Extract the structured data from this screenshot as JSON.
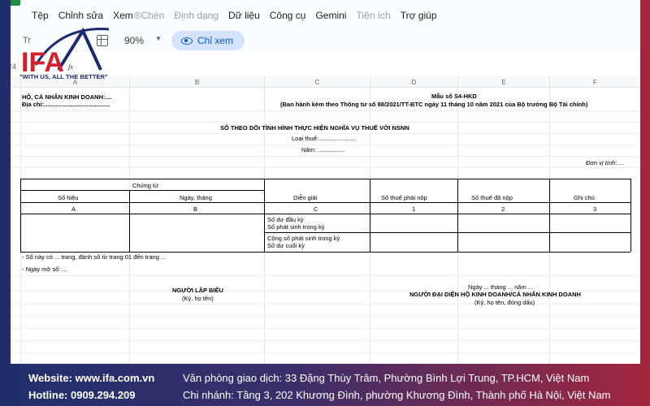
{
  "menu": {
    "items": [
      {
        "label": "Tệp",
        "disabled": false
      },
      {
        "label": "Chỉnh sửa",
        "disabled": false
      },
      {
        "label": "Xem",
        "disabled": false
      },
      {
        "label": "®Chèn",
        "disabled": true
      },
      {
        "label": "Định dạng",
        "disabled": true
      },
      {
        "label": "Dữ liệu",
        "disabled": false
      },
      {
        "label": "Công cụ",
        "disabled": false
      },
      {
        "label": "Gemini",
        "disabled": false
      },
      {
        "label": "Tiện ích",
        "disabled": true
      },
      {
        "label": "Trợ giúp",
        "disabled": false
      }
    ]
  },
  "toolbar": {
    "search_label": "Tr",
    "zoom": "90%",
    "view_button": "Chỉ xem"
  },
  "cell_ref": "24",
  "logo": {
    "letters": "IFA",
    "fx": "fx",
    "tagline": "\"WITH US, ALL THE BETTER\""
  },
  "columns": [
    "A",
    "B",
    "C",
    "D",
    "E",
    "F"
  ],
  "sheet": {
    "org_name": "HỘ, CÁ NHÂN KINH DOANH:....",
    "address": "Địa chỉ:.......................................",
    "form_code": "Mẫu số S4-HKD",
    "form_note": "(Ban hành kèm theo Thông tư số 88/2021/TT-BTC ngày 11 tháng 10 năm 2021 của Bộ trưởng Bộ Tài chính)",
    "title": "SỔ THEO DÕI TÌNH HÌNH THỰC HIỆN NGHĨA VỤ THUẾ VỚI NSNN",
    "tax_type": "Loại thuế:......................",
    "year": "Năm: ................",
    "unit": "Đơn vị tính:....",
    "table": {
      "group_header": "Chứng từ",
      "headers": [
        "Số hiệu",
        "Ngày, tháng",
        "Diễn giải",
        "Số thuế phải nộp",
        "Số thuế đã nộp",
        "Ghi chú"
      ],
      "codes": [
        "A",
        "B",
        "C",
        "1",
        "2",
        "3"
      ],
      "rows": [
        "Số dư đầu kỳ",
        "Số phát sinh trong kỳ",
        "Cộng số phát sinh trong kỳ",
        "Số dư cuối kỳ"
      ]
    },
    "pages_note": "- Sổ này có ... trang, đánh số từ trang 01 đến trang ...",
    "open_date": "- Ngày mở sổ: ...",
    "preparer": "NGƯỜI LẬP BIỂU",
    "preparer_sign": "(Ký, họ tên)",
    "date_line": "Ngày ... tháng ... năm ...",
    "representative": "NGƯỜI ĐẠI DIỆN HỘ KINH DOANH/CÁ NHÂN KINH DOANH",
    "representative_sign": "(Ký, họ tên, đóng dấu)"
  },
  "footer": {
    "website": "Website: www.ifa.com.vn",
    "hotline": "Hotline: 0909.294.209",
    "office": "Văn phòng giao dịch: 33 Đặng Thùy Trâm, Phường Bình Lợi Trung, TP.HCM, Việt Nam",
    "branch": "Chi nhánh: Tầng 3, 202 Khương Đình, phường Khương Đình, Thành phố Hà Nội, Việt Nam"
  },
  "colors": {
    "accent": "#0b57d0",
    "view_button_bg": "#d3e3fd",
    "logo_blue": "#1a2a6c",
    "logo_red": "#d6202f"
  }
}
